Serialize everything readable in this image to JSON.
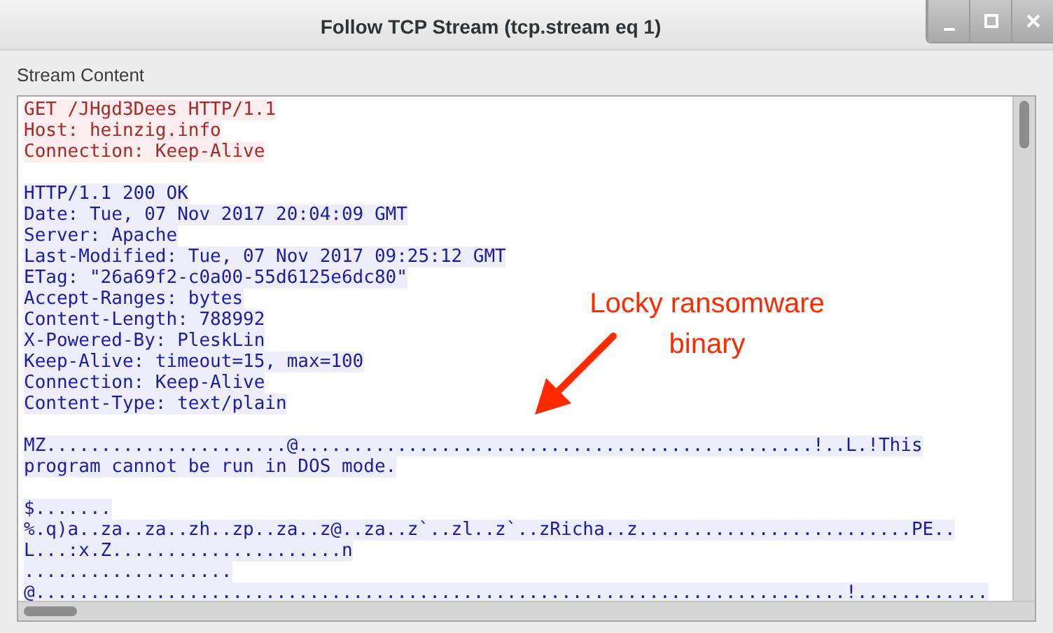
{
  "window": {
    "title": "Follow TCP Stream (tcp.stream eq 1)",
    "controls": [
      {
        "kind": "minimize"
      },
      {
        "kind": "maximize"
      },
      {
        "kind": "close"
      }
    ]
  },
  "stream_label": "Stream Content",
  "lines": [
    {
      "kind": "client",
      "text": "GET /JHgd3Dees HTTP/1.1"
    },
    {
      "kind": "client",
      "text": "Host: heinzig.info"
    },
    {
      "kind": "client",
      "text": "Connection: Keep-Alive"
    },
    {
      "kind": "blank"
    },
    {
      "kind": "server",
      "text": "HTTP/1.1 200 OK"
    },
    {
      "kind": "server",
      "text": "Date: Tue, 07 Nov 2017 20:04:09 GMT"
    },
    {
      "kind": "server",
      "text": "Server: Apache"
    },
    {
      "kind": "server",
      "text": "Last-Modified: Tue, 07 Nov 2017 09:25:12 GMT"
    },
    {
      "kind": "server",
      "text": "ETag: \"26a69f2-c0a00-55d6125e6dc80\""
    },
    {
      "kind": "server",
      "text": "Accept-Ranges: bytes"
    },
    {
      "kind": "server",
      "text": "Content-Length: 788992"
    },
    {
      "kind": "server",
      "text": "X-Powered-By: PleskLin"
    },
    {
      "kind": "server",
      "text": "Keep-Alive: timeout=15, max=100"
    },
    {
      "kind": "server",
      "text": "Connection: Keep-Alive"
    },
    {
      "kind": "server",
      "text": "Content-Type: text/plain"
    },
    {
      "kind": "blank"
    },
    {
      "kind": "server",
      "text": "MZ......................@...............................................!..L.!This"
    },
    {
      "kind": "server",
      "text": "program cannot be run in DOS mode."
    },
    {
      "kind": "blank"
    },
    {
      "kind": "server",
      "text": "$......."
    },
    {
      "kind": "server",
      "text": "%.q)a..za..za..zh..zp..za..z@..za..z`..zl..z`..zRicha..z.........................PE.."
    },
    {
      "kind": "server",
      "text": "L...:x.Z.....................n"
    },
    {
      "kind": "server",
      "text": "..................."
    },
    {
      "kind": "server",
      "text": "@..........................................................................!............"
    }
  ],
  "annotation": {
    "text": "Locky ransomware binary"
  }
}
